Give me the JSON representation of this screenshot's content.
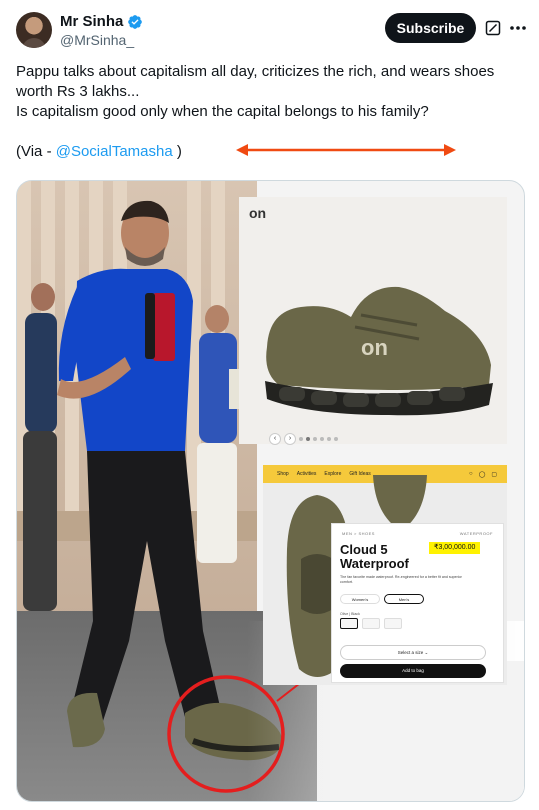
{
  "author": {
    "display_name": "Mr Sinha",
    "handle": "@MrSinha_",
    "verified_icon": "verified-badge-icon"
  },
  "header": {
    "subscribe_label": "Subscribe",
    "grok_icon": "grok-icon",
    "more_icon": "more-options-icon"
  },
  "tweet": {
    "line1": "Pappu talks about capitalism all day, criticizes the rich, and wears shoes worth Rs 3 lakhs...",
    "line2": "Is capitalism good only when the capital belongs to his family?",
    "via_prefix": "(Via - ",
    "via_mention": "@SocialTamasha",
    "via_suffix": " )",
    "mention_color": "#1d9bf0"
  },
  "annotations": {
    "arrow_color": "#f04a12",
    "highlight_circle_color": "#e41e1e"
  },
  "media": {
    "product_logo": "on",
    "shop_nav": [
      "Shop",
      "Activities",
      "Explore",
      "Gift Ideas"
    ],
    "shop_nav_icons": [
      "search-icon",
      "account-icon",
      "bag-icon"
    ],
    "breadcrumb": "MEN  >  SHOES",
    "tag": "WATERPROOF",
    "product_title_line1": "Cloud 5",
    "product_title_line2": "Waterproof",
    "price": "₹3,00,000.00",
    "description": "The fan favorite made waterproof. Re-engineered for a better fit and superior comfort.",
    "gender_options": [
      "Women's",
      "Men's"
    ],
    "selected_gender": "Men's",
    "color_label": "Olive | Black",
    "size_select_label": "Select a size",
    "add_to_bag_label": "Add to bag",
    "shoe_color": "#6a6748"
  }
}
